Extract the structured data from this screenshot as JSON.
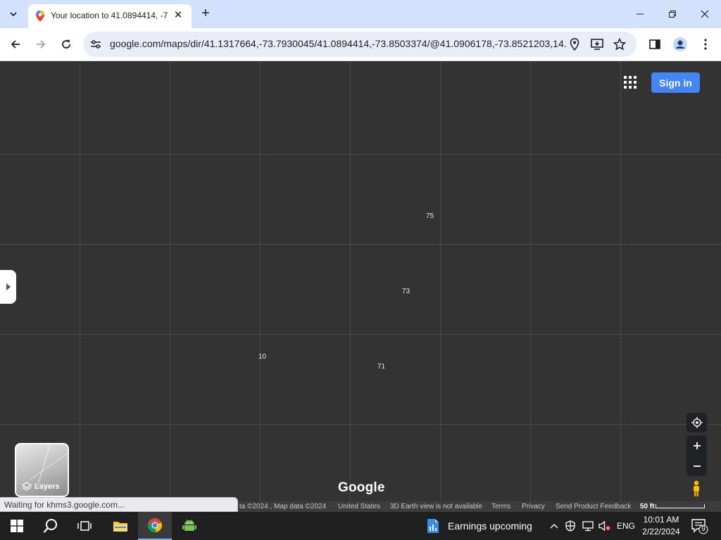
{
  "browser": {
    "tab_title": "Your location to 41.0894414, -7",
    "url": "google.com/maps/dir/41.1317664,-73.7930045/41.0894414,-73.8503374/@41.0906178,-73.8521203,14..."
  },
  "map": {
    "sign_in_label": "Sign in",
    "road_numbers": [
      "75",
      "73",
      "10",
      "71"
    ],
    "layers_label": "Layers",
    "google_logo": "Google",
    "footer": {
      "map_data": "ta ©2024 , Map data ©2024",
      "country": "United States",
      "earth_note": "3D Earth view is not available",
      "terms": "Terms",
      "privacy": "Privacy",
      "feedback": "Send Product Feedback",
      "scale": "50 ft"
    },
    "status_text": "Waiting for khms3.google.com..."
  },
  "taskbar": {
    "news_text": "Earnings upcoming",
    "language": "ENG",
    "time": "10:01 AM",
    "date": "2/22/2024",
    "notification_count": "9"
  },
  "colors": {
    "map_bg": "#333333",
    "sign_in": "#4285f4",
    "tabstrip": "#d3e3fd"
  }
}
